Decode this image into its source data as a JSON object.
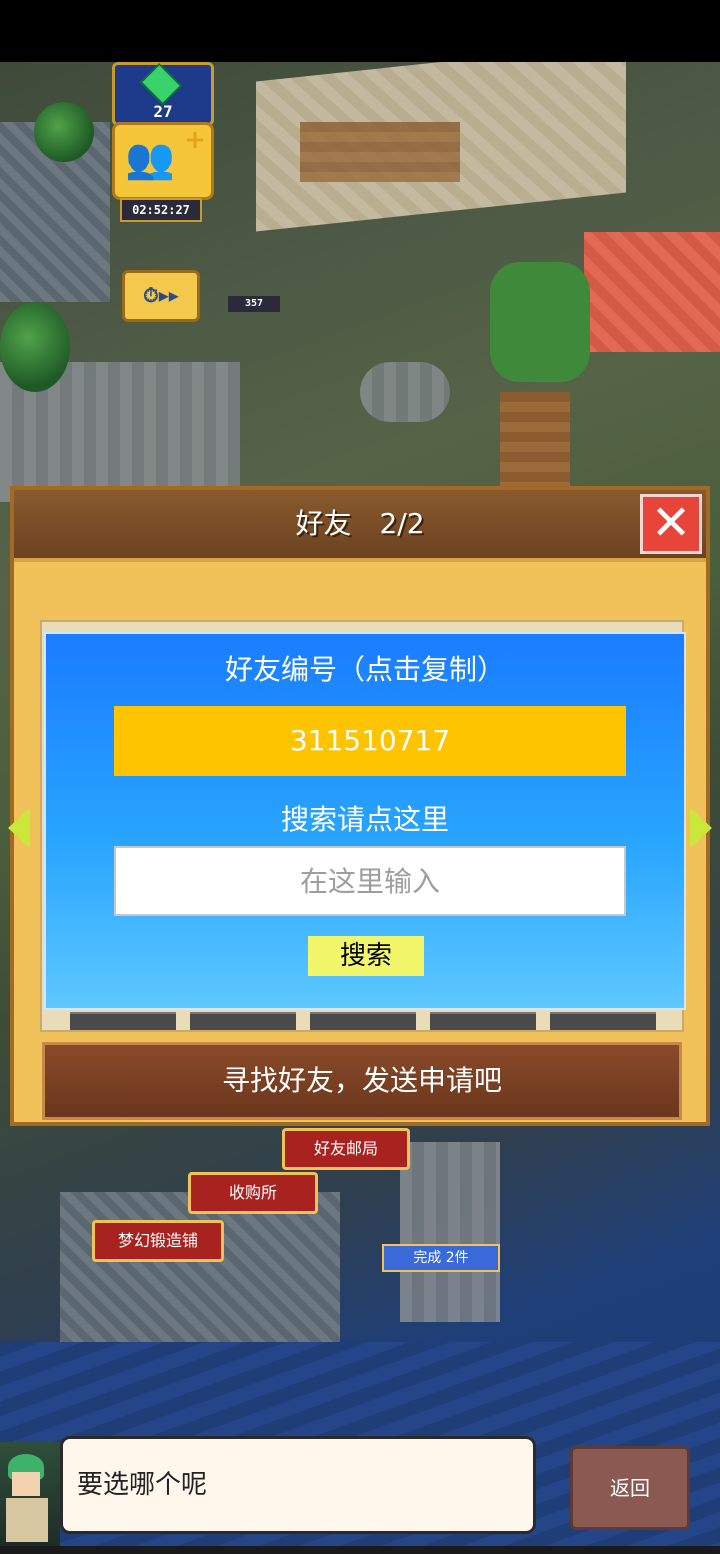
{
  "hud": {
    "gems": "27",
    "timer": "02:52:27",
    "level_badge": "357",
    "icons": [
      "gem-icon",
      "friends-icon",
      "plus-icon",
      "stopwatch-icon",
      "fast-forward-icon"
    ]
  },
  "dialog": {
    "title": "好友　2/2",
    "friend_id_label": "好友编号（点击复制）",
    "friend_id": "311510717",
    "search_label": "搜索请点这里",
    "search_placeholder": "在这里输入",
    "search_button": "搜索",
    "find_button": "寻找好友，发送申请吧"
  },
  "buildings": {
    "post_office": "好友邮局",
    "shop": "收购所",
    "forge": "梦幻锻造铺",
    "done_badge": "完成 2件"
  },
  "footer": {
    "message": "要选哪个呢",
    "back_button": "返回"
  },
  "colors": {
    "dialog_bg": "#f2c25a",
    "header_bg": "#7a4c26",
    "panel_blue": "#1a7cff",
    "id_field": "#ffc400",
    "search_btn": "#f2f66a",
    "close_red": "#e8453a"
  }
}
